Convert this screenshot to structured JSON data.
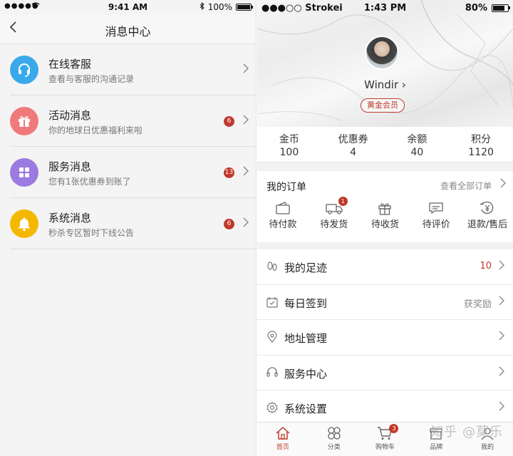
{
  "left": {
    "status": {
      "signal": "●●●●●",
      "time": "9:41 AM",
      "battery": "100%",
      "battery_level": 1.0
    },
    "nav": {
      "back_icon": "chevron-left-icon",
      "title": "消息中心"
    },
    "messages": [
      {
        "title": "在线客服",
        "subtitle": "查看与客服的沟通记录",
        "badge": "",
        "icon": "headset-icon",
        "color": "#3aa9ea"
      },
      {
        "title": "活动消息",
        "subtitle": "你的地球日优惠福利来啦",
        "badge": "6",
        "icon": "gift-icon",
        "color": "#f07a7a"
      },
      {
        "title": "服务消息",
        "subtitle": "您有1张优惠券到账了",
        "badge": "13",
        "icon": "grid-icon",
        "color": "#9b7be0"
      },
      {
        "title": "系统消息",
        "subtitle": "秒杀专区暂时下线公告",
        "badge": "6",
        "icon": "bell-icon",
        "color": "#f5b800"
      }
    ]
  },
  "right": {
    "status": {
      "carrier": "●●●○○ Strokei",
      "time": "1:43 PM",
      "battery": "80%",
      "battery_level": 0.8
    },
    "profile": {
      "username": "Windir ›",
      "member": "黄金会员"
    },
    "stats": [
      {
        "label": "金币",
        "value": "100"
      },
      {
        "label": "优惠券",
        "value": "4"
      },
      {
        "label": "余额",
        "value": "40"
      },
      {
        "label": "积分",
        "value": "1120"
      }
    ],
    "orders": {
      "title": "我的订单",
      "view_all": "查看全部订单",
      "items": [
        {
          "label": "待付款",
          "icon": "wallet-icon",
          "badge": ""
        },
        {
          "label": "待发货",
          "icon": "truck-icon",
          "badge": "1"
        },
        {
          "label": "待收货",
          "icon": "gift-box-icon",
          "badge": ""
        },
        {
          "label": "待评价",
          "icon": "comment-icon",
          "badge": ""
        },
        {
          "label": "退款/售后",
          "icon": "refund-icon",
          "badge": ""
        }
      ]
    },
    "menu": [
      {
        "label": "我的足迹",
        "value": "10",
        "icon": "footprint-icon"
      },
      {
        "label": "每日签到",
        "value": "获奖励",
        "icon": "calendar-icon"
      },
      {
        "label": "地址管理",
        "value": "",
        "icon": "location-icon"
      },
      {
        "label": "服务中心",
        "value": "",
        "icon": "headset-icon"
      },
      {
        "label": "系统设置",
        "value": "",
        "icon": "gear-icon"
      }
    ],
    "tabs": [
      {
        "label": "首页",
        "icon": "home-icon",
        "badge": ""
      },
      {
        "label": "分类",
        "icon": "category-icon",
        "badge": ""
      },
      {
        "label": "购物车",
        "icon": "cart-icon",
        "badge": "3"
      },
      {
        "label": "品牌",
        "icon": "brand-icon",
        "badge": ""
      },
      {
        "label": "我的",
        "icon": "profile-icon",
        "badge": ""
      }
    ],
    "watermark": "知乎 @莫乐",
    "accent": "#c0392b"
  }
}
